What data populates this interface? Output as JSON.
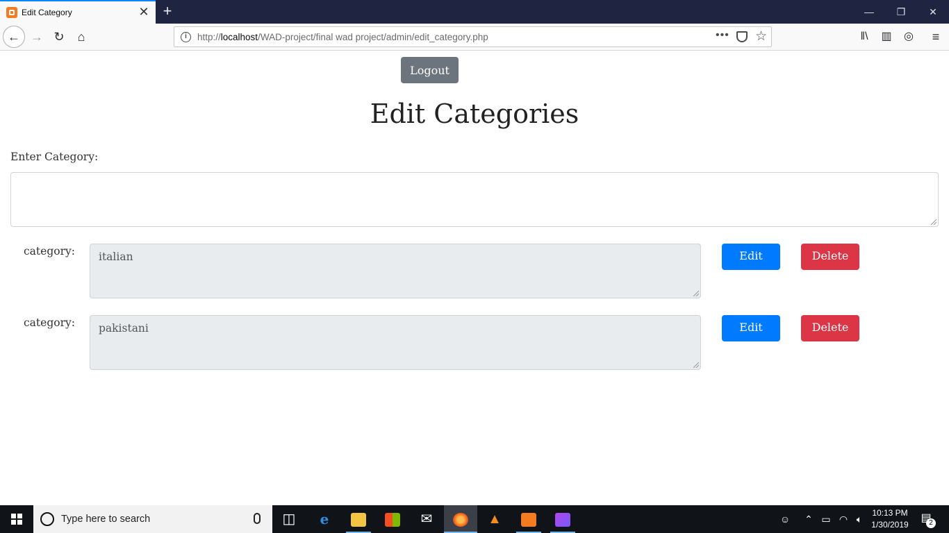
{
  "browser": {
    "tab_title": "Edit Category",
    "tab_close": "✕",
    "new_tab": "+",
    "url_host": "localhost",
    "url_prefix": "http://",
    "url_path": "/WAD-project/final wad project/admin/edit_category.php",
    "icons": [
      "back-icon",
      "forward-icon",
      "reload-icon",
      "home-icon",
      "info-icon",
      "more-icon",
      "pocket-icon",
      "bookmark-star-icon",
      "library-icon",
      "sidebar-icon",
      "sync-icon",
      "menu-icon"
    ]
  },
  "page": {
    "logout_label": "Logout",
    "title": "Edit Categories",
    "enter_label": "Enter Category:",
    "categories": [
      {
        "label": "category:",
        "value": "italian",
        "edit_label": "Edit",
        "delete_label": "Delete"
      },
      {
        "label": "category:",
        "value": "pakistani",
        "edit_label": "Edit",
        "delete_label": "Delete"
      }
    ],
    "colors": {
      "logout": "#6c757d",
      "edit": "#007bff",
      "delete": "#dc3545",
      "readonly_bg": "#e9ecef"
    }
  },
  "taskbar": {
    "search_placeholder": "Type here to search",
    "time": "10:13 PM",
    "date": "1/30/2019",
    "notification_count": "2",
    "apps": [
      "task-view",
      "edge",
      "file-explorer",
      "store",
      "mail",
      "firefox",
      "vlc",
      "xampp",
      "phpstorm"
    ]
  }
}
